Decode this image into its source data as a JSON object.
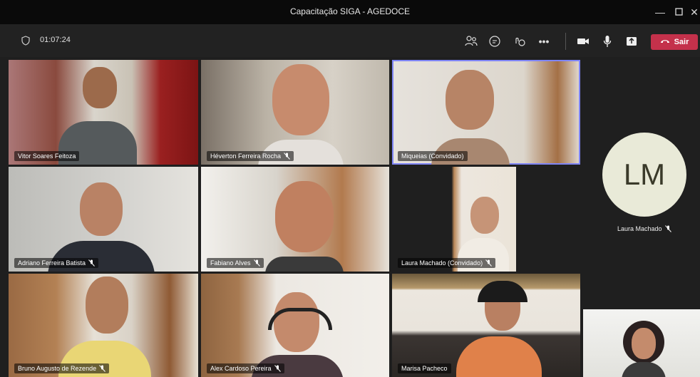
{
  "window": {
    "title": "Capacitação SIGA - AGEDOCE"
  },
  "toolbar": {
    "duration": "01:07:24",
    "leave_label": "Sair"
  },
  "participants": [
    {
      "name": "Vitor Soares Feitoza",
      "muted": false
    },
    {
      "name": "Héverton Ferreira Rocha",
      "muted": true
    },
    {
      "name": "Miqueias (Convidado)",
      "muted": false
    },
    {
      "name": "Adriano Ferreira Batista",
      "muted": true
    },
    {
      "name": "Fabiano Alves",
      "muted": true
    },
    {
      "name": "Laura Machado (Convidado)",
      "muted": true
    },
    {
      "name": "Bruno Augusto de Rezende",
      "muted": true
    },
    {
      "name": "Alex Cardoso Pereira",
      "muted": true
    },
    {
      "name": "Marisa Pacheco",
      "muted": false
    }
  ],
  "side_participant": {
    "initials": "LM",
    "name": "Laura Machado",
    "muted": true
  },
  "colors": {
    "leave": "#c4314b",
    "highlight": "#7f85f5",
    "avatar_bg": "#e9ead8"
  },
  "icons": {
    "shield": "shield-icon",
    "people": "people-icon",
    "chat": "chat-icon",
    "reactions": "reactions-icon",
    "more": "more-icon",
    "camera": "camera-icon",
    "mic": "microphone-icon",
    "share": "share-icon",
    "phone": "phone-icon"
  }
}
